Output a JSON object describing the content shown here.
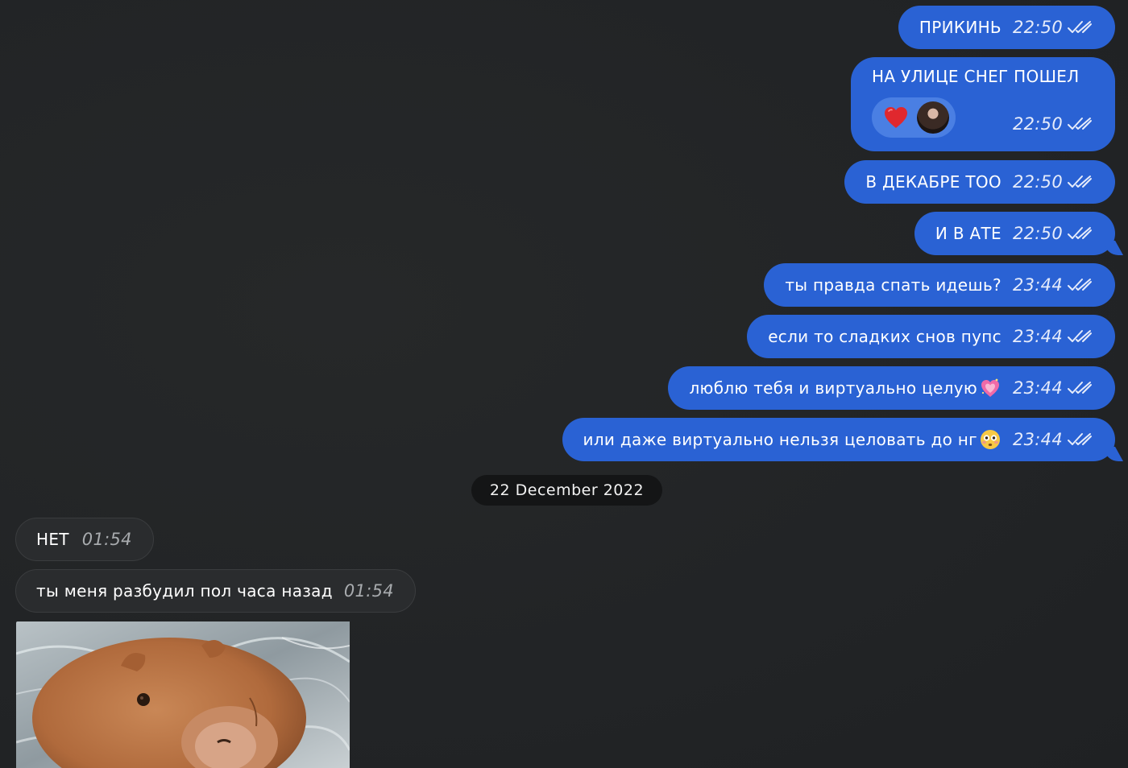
{
  "outgoing": [
    {
      "text": "ПРИКИНЬ",
      "time": "22:50"
    },
    {
      "text": "НА УЛИЦЕ СНЕГ ПОШЕЛ",
      "time": "22:50",
      "reaction": "heart"
    },
    {
      "text": "В ДЕКАБРЕ ТОО",
      "time": "22:50"
    },
    {
      "text": "И В АТЕ",
      "time": "22:50"
    },
    {
      "text": "ты правда спать идешь?",
      "time": "23:44"
    },
    {
      "text": "если то сладких снов пупс",
      "time": "23:44"
    },
    {
      "text": "люблю тебя и виртуально целую",
      "time": "23:44",
      "emoji": "sparkling-heart"
    },
    {
      "text": "или даже виртуально нельзя целовать до нг",
      "time": "23:44",
      "emoji": "flushed-face"
    }
  ],
  "date_separator": "22 December 2022",
  "incoming": [
    {
      "text": "НЕТ",
      "time": "01:54"
    },
    {
      "text": "ты меня разбудил пол часа назад",
      "time": "01:54"
    }
  ],
  "colors": {
    "background": "#222426",
    "outgoing_bubble": "#2a62d4",
    "incoming_bubble": "#2a2c2e",
    "date_pill": "#141516"
  },
  "icons": {
    "read_status": "double-check-icon",
    "reaction": "red-heart-icon",
    "photo_subject": "capybara-photo"
  }
}
